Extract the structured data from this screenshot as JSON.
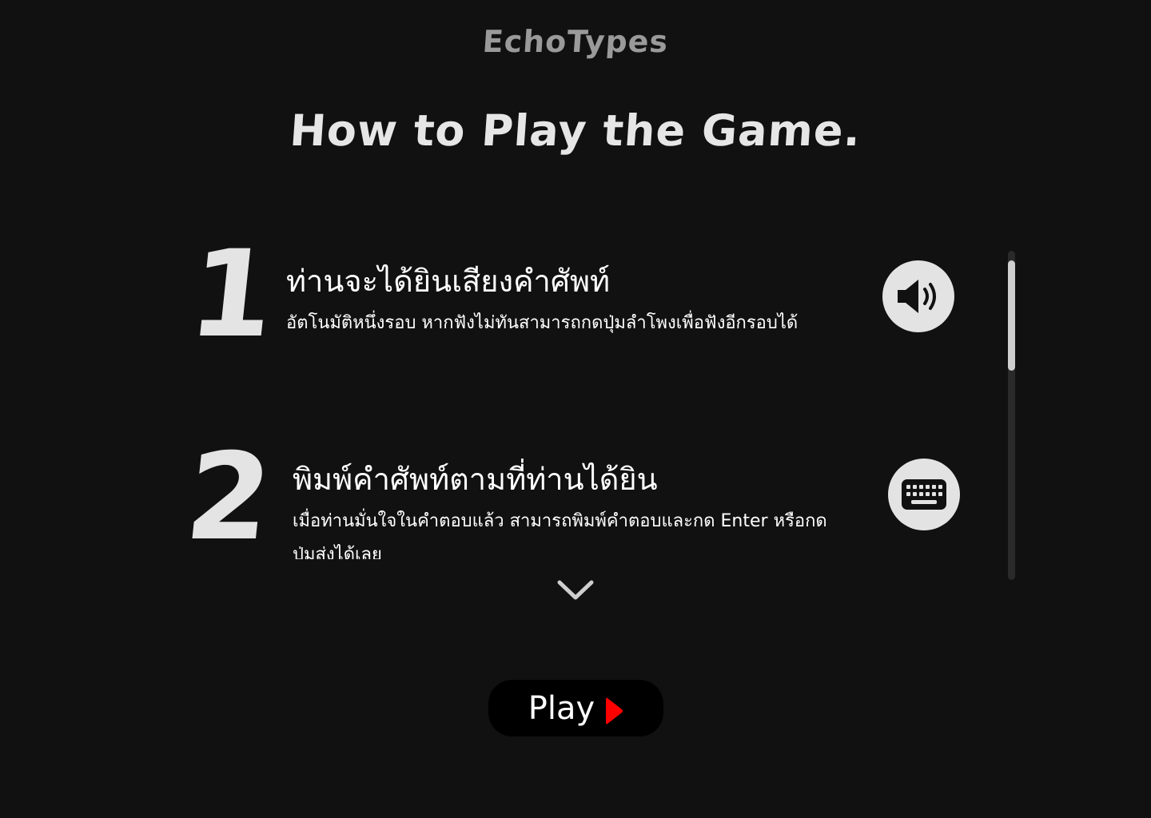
{
  "app": {
    "title": "EchoTypes"
  },
  "page": {
    "heading": "How to Play the Game."
  },
  "steps": [
    {
      "number": "1",
      "title": "ท่านจะได้ยินเสียงคำศัพท์",
      "description": "อัตโนมัติหนึ่งรอบ หากฟังไม่ทันสามารถกดปุ่มลำโพงเพื่อฟังอีกรอบได้",
      "icon": "speaker-icon"
    },
    {
      "number": "2",
      "title": "พิมพ์คำศัพท์ตามที่ท่านได้ยิน",
      "description": "เมื่อท่านมั่นใจในคำตอบแล้ว สามารถพิมพ์คำตอบและกด Enter หรือกดปุ่มส่งได้เลย",
      "icon": "keyboard-icon"
    }
  ],
  "scroll_hint_icon": "chevron-down-icon",
  "play_button": {
    "label": "Play",
    "icon": "play-icon",
    "icon_color": "#ff0000"
  },
  "colors": {
    "background": "#111111",
    "title": "#9a9a9a",
    "heading": "#e6e6e6",
    "icon_circle": "#e3e3e3",
    "play_background": "#000000"
  }
}
